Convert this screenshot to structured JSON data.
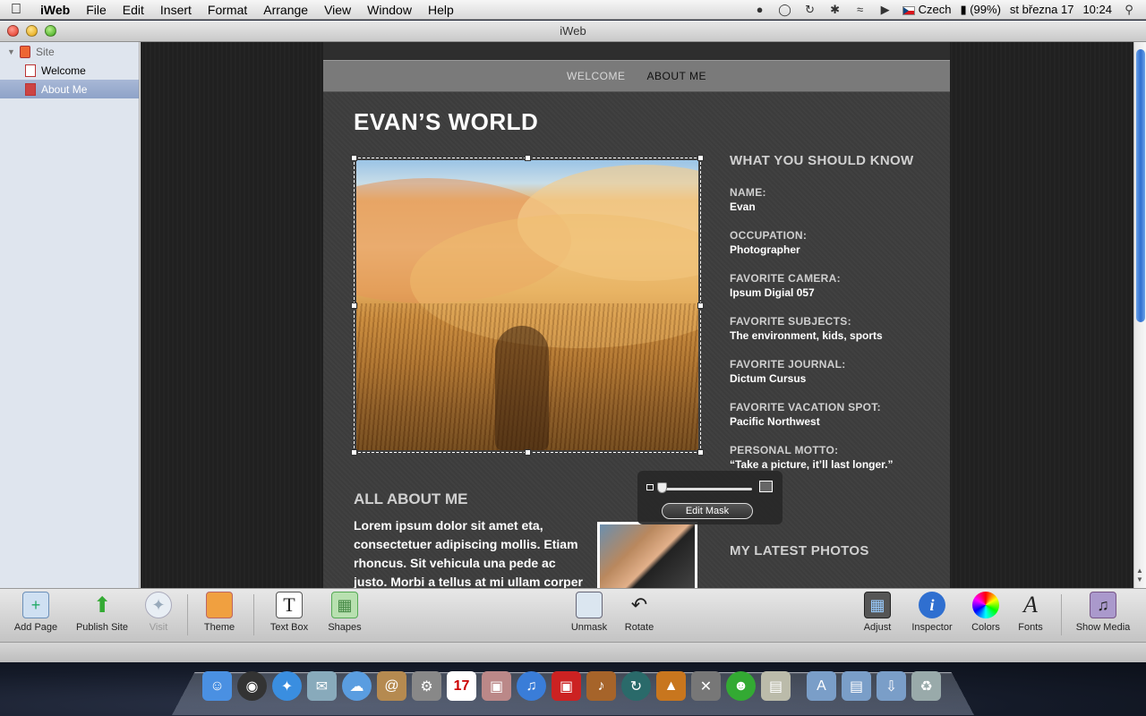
{
  "menubar": {
    "app": "iWeb",
    "items": [
      "File",
      "Edit",
      "Insert",
      "Format",
      "Arrange",
      "View",
      "Window",
      "Help"
    ],
    "status": {
      "language": "Czech",
      "battery": "(99%)",
      "date": "st března 17",
      "time": "10:24"
    }
  },
  "window": {
    "title": "iWeb"
  },
  "sidebar": {
    "site": "Site",
    "pages": [
      {
        "label": "Welcome",
        "selected": false
      },
      {
        "label": "About Me",
        "selected": true
      }
    ]
  },
  "page": {
    "nav": {
      "welcome": "WELCOME",
      "about": "ABOUT ME"
    },
    "title": "EVAN’S WORLD",
    "side_heading": "WHAT YOU SHOULD KNOW",
    "facts": [
      {
        "label": "NAME:",
        "value": "Evan"
      },
      {
        "label": "OCCUPATION:",
        "value": "Photographer"
      },
      {
        "label": "FAVORITE CAMERA:",
        "value": "Ipsum Digial 057"
      },
      {
        "label": "FAVORITE SUBJECTS:",
        "value": "The environment, kids, sports"
      },
      {
        "label": "FAVORITE JOURNAL:",
        "value": "Dictum Cursus"
      },
      {
        "label": "FAVORITE VACATION SPOT:",
        "value": "Pacific Northwest"
      },
      {
        "label": "PERSONAL MOTTO:",
        "value": "“Take a picture, it’ll last longer.”"
      }
    ],
    "latest_heading": "MY LATEST PHOTOS",
    "about_heading": "ALL ABOUT ME",
    "body_text": "Lorem ipsum dolor sit amet eta, consectetuer adipiscing mollis. Etiam rhoncus. Sit vehicula una pede ac justo. Morbi a tellus at mi ullam corper"
  },
  "mask_hud": {
    "button": "Edit Mask"
  },
  "toolbar": {
    "add_page": "Add Page",
    "publish": "Publish Site",
    "visit": "Visit",
    "theme": "Theme",
    "text_box": "Text Box",
    "shapes": "Shapes",
    "unmask": "Unmask",
    "rotate": "Rotate",
    "adjust": "Adjust",
    "inspector": "Inspector",
    "colors": "Colors",
    "fonts": "Fonts",
    "show_media": "Show Media"
  },
  "dock": {
    "calendar_day": "17"
  },
  "colors": {
    "accent": "#3a74d4",
    "page_bg": "#3c3c3c",
    "nav_bg": "#7a7a7a"
  }
}
